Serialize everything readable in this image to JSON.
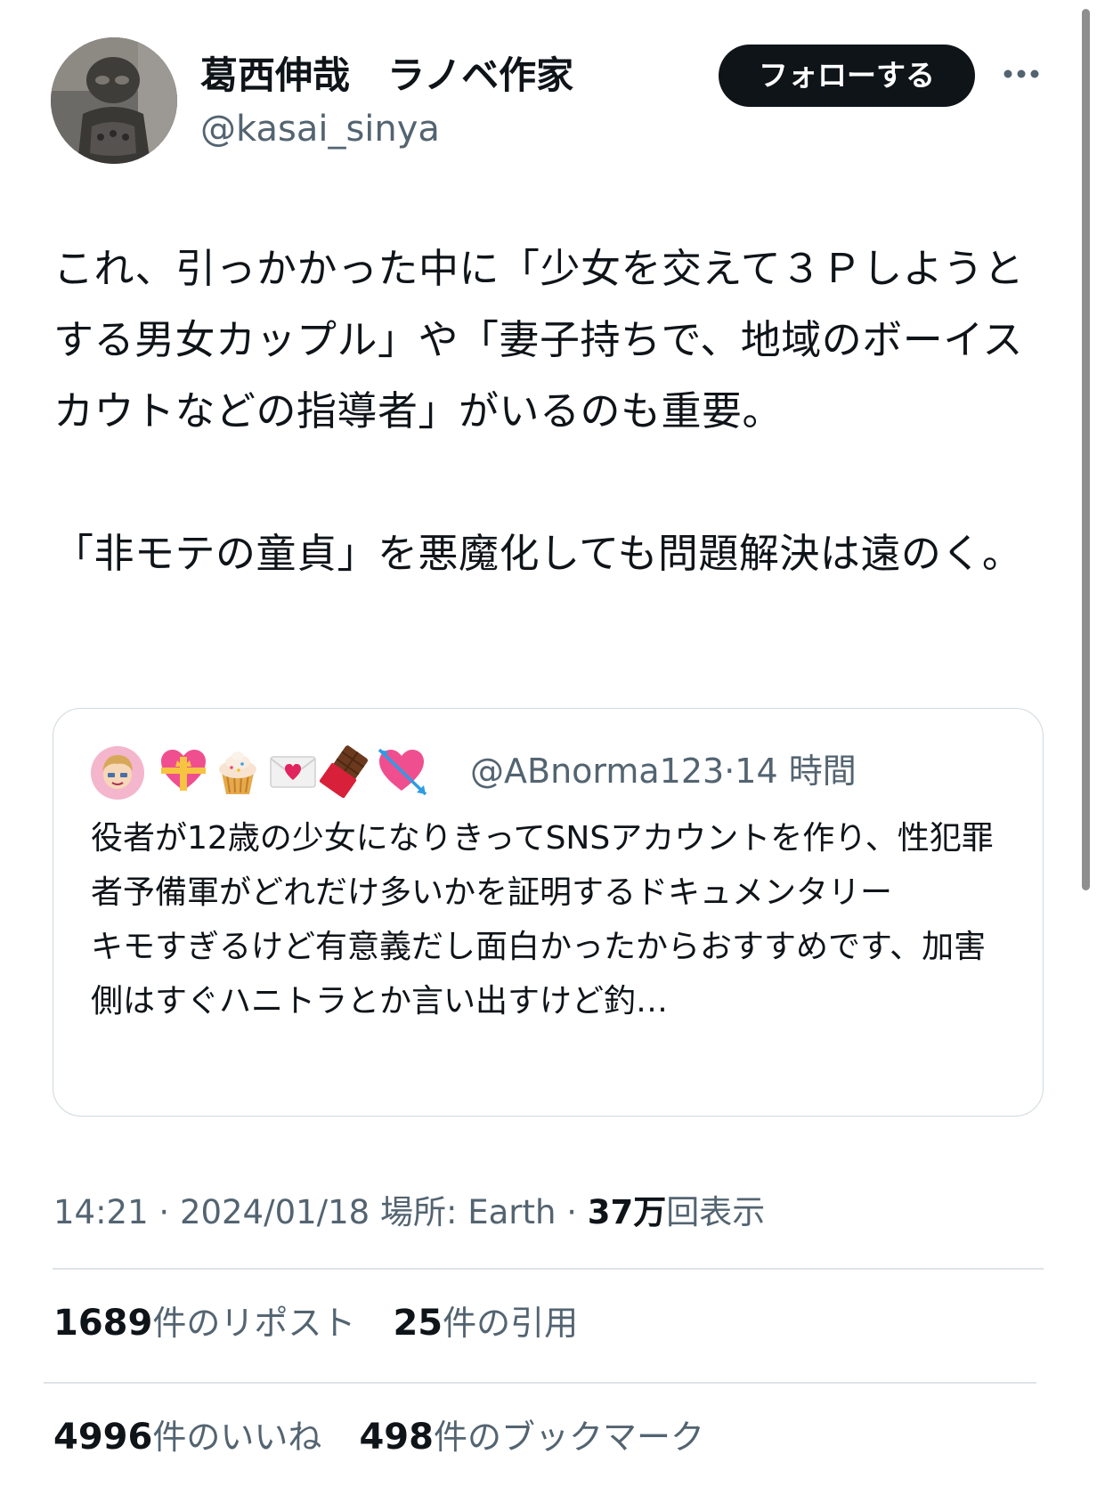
{
  "author": {
    "display_name": "葛西伸哉　ラノベ作家",
    "handle": "@kasai_sinya",
    "avatar_icon": "profile-photo-statue"
  },
  "actions": {
    "follow_label": "フォローする",
    "more_icon": "more-horizontal-icon"
  },
  "tweet": {
    "text": "これ、引っかかった中に「少女を交えて３Ｐしようとする男女カップル」や「妻子持ちで、地域のボーイスカウトなどの指導者」がいるのも重要。\n\n「非モテの童貞」を悪魔化しても問題解決は遠のく。"
  },
  "quote": {
    "handle": "@ABnorma123",
    "separator": "·",
    "time": "14 時間",
    "name_emojis": [
      "sparkling-heart-icon",
      "cupcake-icon",
      "love-letter-icon",
      "chocolate-bar-icon",
      "heart-with-arrow-icon"
    ],
    "text": "役者が12歳の少女になりきってSNSアカウントを作り、性犯罪者予備軍がどれだけ多いかを証明するドキュメンタリー\nキモすぎるけど有意義だし面白かったからおすすめです、加害側はすぐハニトラとか言い出すけど釣…"
  },
  "meta": {
    "time": "14:21",
    "sep1": "·",
    "date": "2024/01/18",
    "location": "場所: Earth",
    "sep2": "·",
    "views_count": "37万",
    "views_label": "回表示"
  },
  "stats": {
    "reposts_count": "1689",
    "reposts_label": "件のリポスト",
    "quotes_count": "25",
    "quotes_label": "件の引用",
    "likes_count": "4996",
    "likes_label": "件のいいね",
    "bookmarks_count": "498",
    "bookmarks_label": "件のブックマーク"
  },
  "colors": {
    "text_primary": "#0f1419",
    "text_secondary": "#536471",
    "border": "#cfd9de",
    "follow_bg": "#0f1419"
  }
}
